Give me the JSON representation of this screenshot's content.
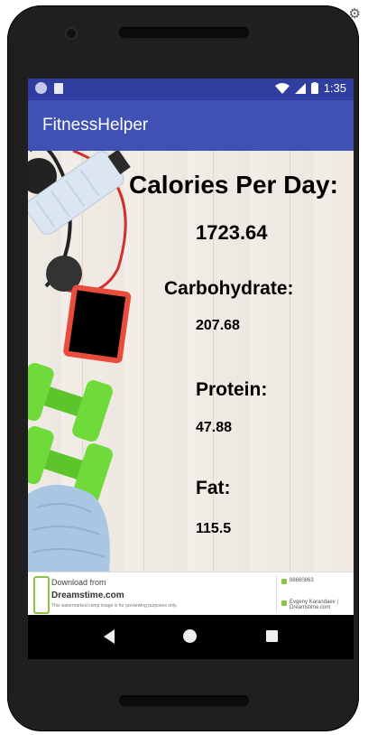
{
  "status_bar": {
    "time": "1:35"
  },
  "app_bar": {
    "title": "FitnessHelper"
  },
  "content": {
    "calories_label": "Calories Per Day:",
    "calories_value": "1723.64",
    "carb_label": "Carbohydrate:",
    "carb_value": "207.68",
    "protein_label": "Protein:",
    "protein_value": "47.88",
    "fat_label": "Fat:",
    "fat_value": "115.5"
  },
  "ad_banner": {
    "line1": "Download from",
    "line2": "Dreamstime.com",
    "line3": "This watermarked comp image is for previewing purposes only.",
    "id": "88660863",
    "credit": "Evgeny Karandaev | Dreamstime.com"
  },
  "colors": {
    "status_bar": "#303F9F",
    "app_bar": "#3F51B5",
    "dumbbell": "#6fdb3a",
    "headphones": "#d32f2f"
  }
}
